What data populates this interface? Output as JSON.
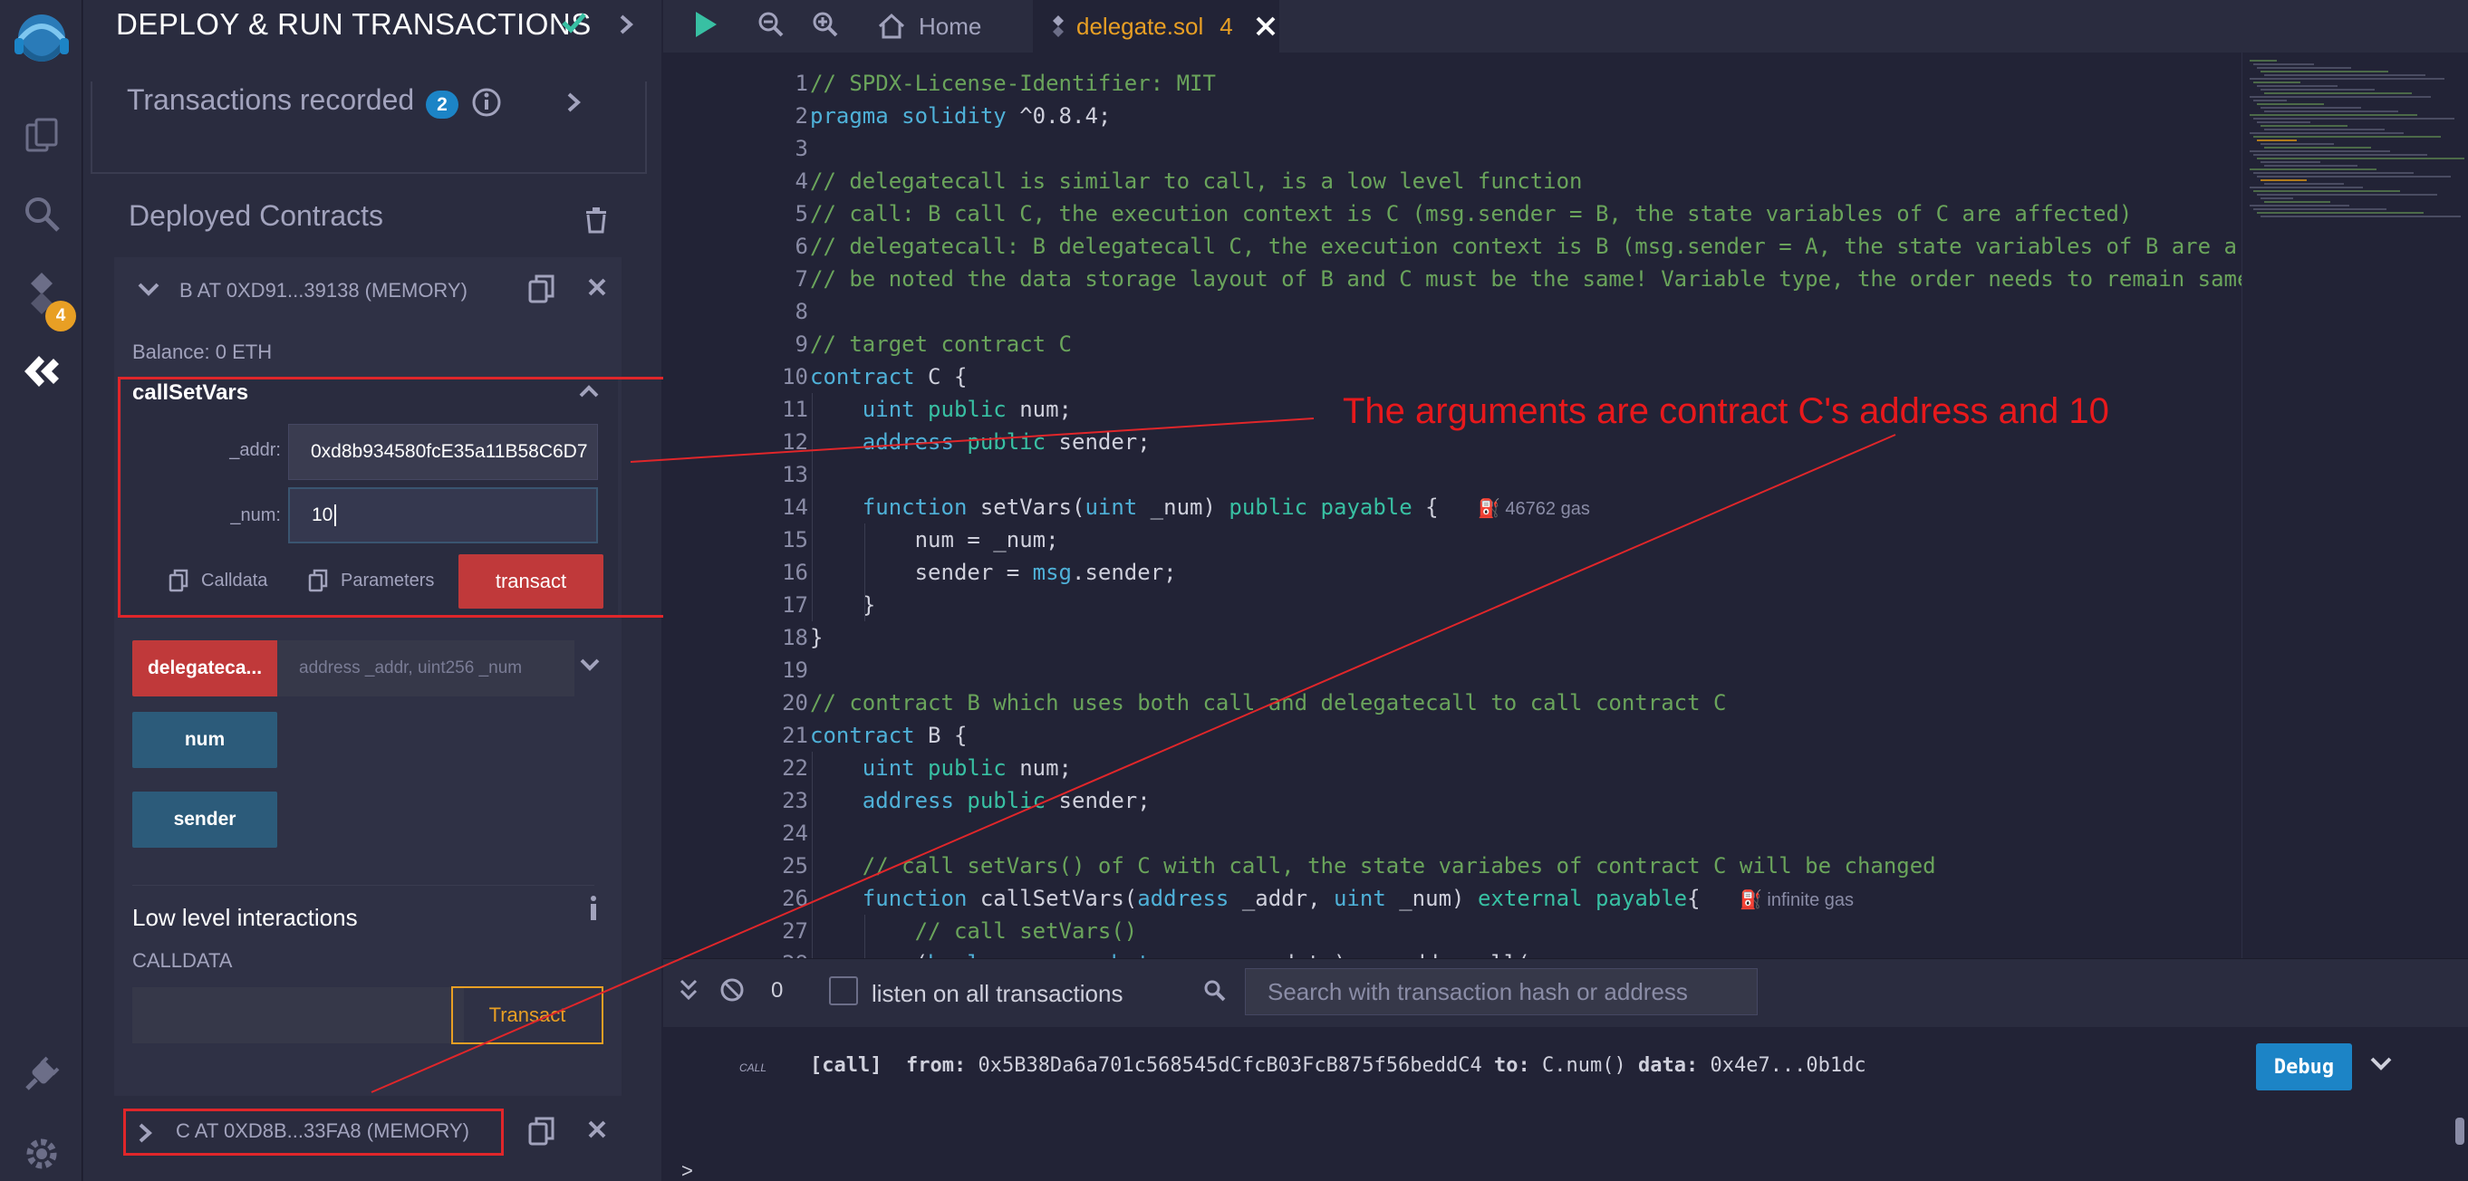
{
  "rail": {
    "plugin_badge": "4"
  },
  "panel": {
    "title": "DEPLOY & RUN TRANSACTIONS",
    "transactions_recorded_label": "Transactions recorded",
    "transactions_recorded_count": "2",
    "deployed_contracts_label": "Deployed Contracts",
    "contract_b": {
      "header": "B AT 0XD91...39138 (MEMORY)",
      "balance": "Balance: 0 ETH",
      "call_set_vars": {
        "name": "callSetVars",
        "addr_label": "_addr:",
        "addr_value": "0xd8b934580fcE35a11B58C6D7",
        "num_label": "_num:",
        "num_value": "10",
        "calldata_label": "Calldata",
        "parameters_label": "Parameters",
        "transact_label": "transact"
      },
      "delegatecall_button": "delegateca...",
      "delegatecall_placeholder": "address _addr, uint256 _num",
      "num_button": "num",
      "sender_button": "sender",
      "low_level_title": "Low level interactions",
      "calldata_label": "CALLDATA",
      "low_level_transact": "Transact"
    },
    "contract_c": {
      "header": "C AT 0XD8B...33FA8 (MEMORY)"
    }
  },
  "editor": {
    "tabs": {
      "home": "Home",
      "active_file": "delegate.sol",
      "active_file_badge": "4"
    },
    "lines": [
      {
        "n": "1",
        "html": "<span class='t-cm'>// SPDX-License-Identifier: MIT</span>"
      },
      {
        "n": "2",
        "html": "<span class='t-kw'>pragma</span> <span class='t-kw'>solidity</span> ^0.8.4;"
      },
      {
        "n": "3",
        "html": ""
      },
      {
        "n": "4",
        "html": "<span class='t-cm'>// delegatecall is similar to call, is a low level function</span>"
      },
      {
        "n": "5",
        "html": "<span class='t-cm'>// call: B call C, the execution context is C (msg.sender = B, the state variables of C are affected)</span>"
      },
      {
        "n": "6",
        "html": "<span class='t-cm'>// delegatecall: B delegatecall C, the execution context is B (msg.sender = A, the state variables of B are a</span>"
      },
      {
        "n": "7",
        "html": "<span class='t-cm'>// be noted the data storage layout of B and C must be the same! Variable type, the order needs to remain same</span>"
      },
      {
        "n": "8",
        "html": ""
      },
      {
        "n": "9",
        "html": "<span class='t-cm'>// target contract C</span>"
      },
      {
        "n": "10",
        "html": "<span class='t-kw'>contract</span> C {"
      },
      {
        "n": "11",
        "html": "    <span class='t-kw'>uint</span> <span class='t-kw2'>public</span> num;"
      },
      {
        "n": "12",
        "html": "    <span class='t-kw'>address</span> <span class='t-kw2'>public</span> sender;"
      },
      {
        "n": "13",
        "html": ""
      },
      {
        "n": "14",
        "html": "    <span class='t-kw'>function</span> setVars(<span class='t-kw'>uint</span> _num) <span class='t-kw2'>public</span> <span class='t-kw2'>payable</span> {   <span class='gas-hint'>&#9981; 46762 gas</span>"
      },
      {
        "n": "15",
        "html": "        num = _num;"
      },
      {
        "n": "16",
        "html": "        sender = <span class='t-kw'>msg</span>.sender;"
      },
      {
        "n": "17",
        "html": "    }"
      },
      {
        "n": "18",
        "html": "}"
      },
      {
        "n": "19",
        "html": ""
      },
      {
        "n": "20",
        "html": "<span class='t-cm'>// contract B which uses both call and delegatecall to call contract C</span>"
      },
      {
        "n": "21",
        "html": "<span class='t-kw'>contract</span> B {"
      },
      {
        "n": "22",
        "html": "    <span class='t-kw'>uint</span> <span class='t-kw2'>public</span> num;"
      },
      {
        "n": "23",
        "html": "    <span class='t-kw'>address</span> <span class='t-kw2'>public</span> sender;"
      },
      {
        "n": "24",
        "html": ""
      },
      {
        "n": "25",
        "html": "    <span class='t-cm'>// call setVars() of C with call, the state variabes of contract C will be changed</span>"
      },
      {
        "n": "26",
        "html": "    <span class='t-kw'>function</span> callSetVars(<span class='t-kw'>address</span> _addr, <span class='t-kw'>uint</span> _num) <span class='t-kw2'>external</span> <span class='t-kw2'>payable</span>{   <span class='gas-hint'>&#9981; infinite gas</span>"
      },
      {
        "n": "27",
        "html": "        <span class='t-cm'>// call setVars()</span>"
      },
      {
        "n": "28",
        "html": "        (<span class='t-kw'>bool</span> success, <span class='t-kw'>bytes</span> <span class='t-kw2'>memory</span> data) = _addr.call("
      }
    ]
  },
  "terminal": {
    "pending_count": "0",
    "listen_label": "listen on all transactions",
    "search_placeholder": "Search with transaction hash or address",
    "log_tag": "CALL",
    "log_line_html": "<b>[call]</b>  <b>from:</b> 0x5B38Da6a701c568545dCfcB03FcB875f56beddC4 <b>to:</b> C.num() <b>data:</b> 0x4e7...0b1dc",
    "debug_label": "Debug",
    "prompt": ">"
  },
  "annotation": {
    "text": "The arguments are contract C's address and 10",
    "color": "#e8191c"
  },
  "colors": {
    "accent_orange": "#e89f24",
    "transact_red": "#c0393a",
    "call_blue": "#2c5b7a",
    "debug_blue": "#1c84c6"
  }
}
